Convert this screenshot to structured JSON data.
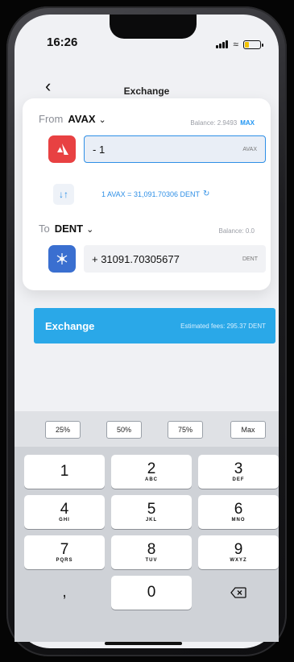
{
  "status": {
    "time": "16:26"
  },
  "header": {
    "title": "Exchange"
  },
  "from": {
    "label": "From",
    "token": "AVAX",
    "balance": "Balance: 2.9493",
    "max_label": "MAX",
    "amount": "- 1",
    "unit": "AVAX"
  },
  "rate": {
    "text": "1 AVAX = 31,091.70306 DENT"
  },
  "to": {
    "label": "To",
    "token": "DENT",
    "balance": "Balance: 0.0",
    "amount": "+ 31091.70305677",
    "unit": "DENT"
  },
  "exchange": {
    "label": "Exchange",
    "fees": "Estimated fees: 295.37 DENT"
  },
  "percent_buttons": [
    "25%",
    "50%",
    "75%",
    "Max"
  ],
  "keypad": [
    {
      "digit": "1",
      "letters": ""
    },
    {
      "digit": "2",
      "letters": "ABC"
    },
    {
      "digit": "3",
      "letters": "DEF"
    },
    {
      "digit": "4",
      "letters": "GHI"
    },
    {
      "digit": "5",
      "letters": "JKL"
    },
    {
      "digit": "6",
      "letters": "MNO"
    },
    {
      "digit": "7",
      "letters": "PQRS"
    },
    {
      "digit": "8",
      "letters": "TUV"
    },
    {
      "digit": "9",
      "letters": "WXYZ"
    },
    {
      "digit": ",",
      "letters": ""
    },
    {
      "digit": "0",
      "letters": ""
    }
  ],
  "colors": {
    "accent": "#2aa8e8",
    "avax": "#e84142",
    "dent": "#3a6fd0"
  }
}
